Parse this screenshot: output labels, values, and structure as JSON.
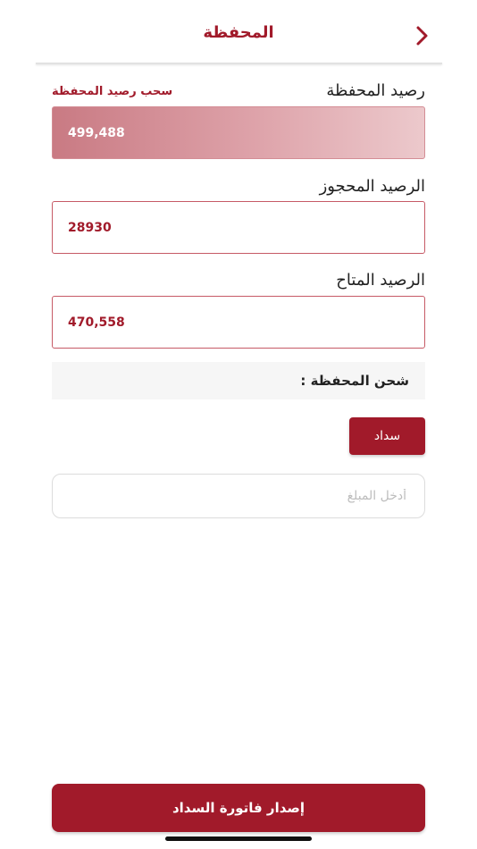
{
  "header": {
    "title": "المحفظة",
    "back_icon": "chevron-right-icon",
    "accent_color": "#a11a2a"
  },
  "wallet": {
    "balance_label": "رصيد المحفظة",
    "withdraw_link": "سحب رصيد المحفظة",
    "balance_value": "499,488",
    "reserved_label": "الرصيد المحجوز",
    "reserved_value": "28930",
    "available_label": "الرصيد المتاح",
    "available_value": "470,558"
  },
  "recharge": {
    "label": "شحن المحفظة :",
    "pay_button": "سداد",
    "amount_placeholder": "أدخل المبلغ",
    "amount_value": ""
  },
  "footer": {
    "issue_button": "إصدار فاتورة السداد"
  }
}
